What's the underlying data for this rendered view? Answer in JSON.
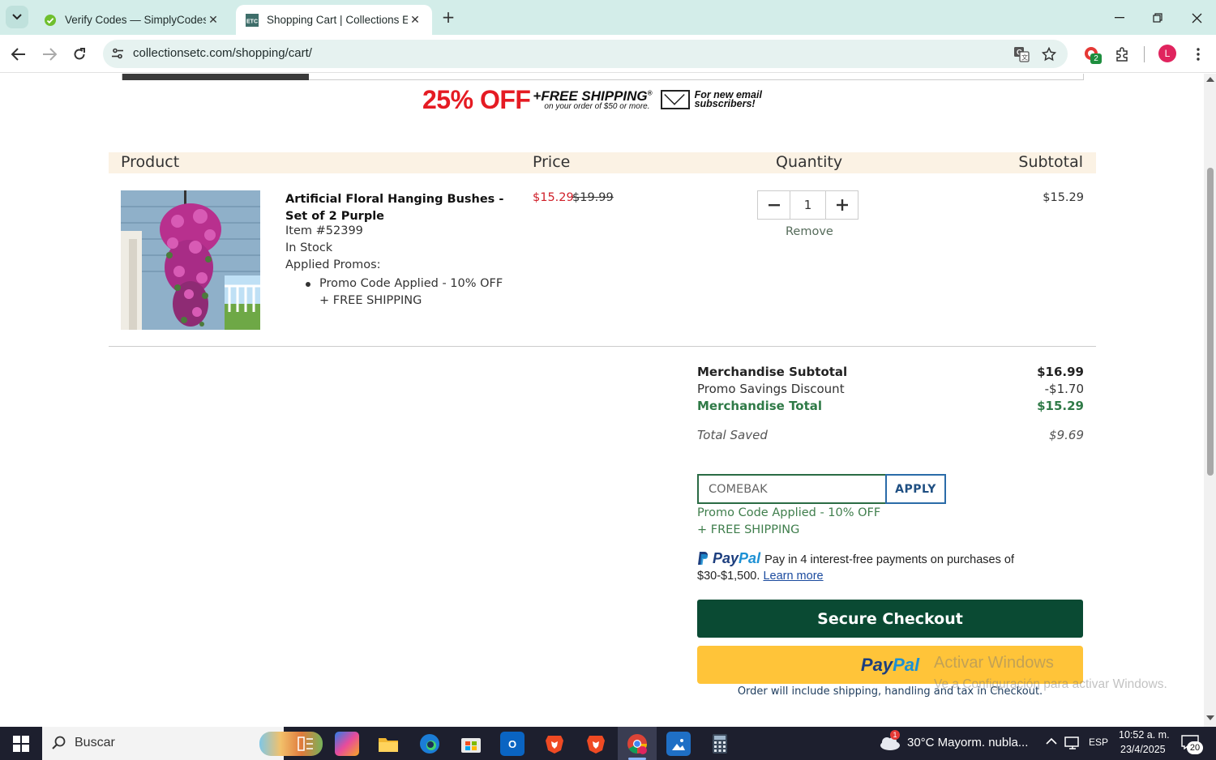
{
  "browser": {
    "tabs": [
      {
        "title": "Verify Codes — SimplyCodes",
        "active": false
      },
      {
        "title": "Shopping Cart | Collections Etc.",
        "active": true
      }
    ],
    "active_favicon_text": "ETC",
    "url": "collectionsetc.com/shopping/cart/",
    "extension_badge": "2",
    "profile_initial": "L"
  },
  "banner": {
    "discount": "25% OFF",
    "shipping": "+FREE SHIPPING",
    "shipping_reg": "®",
    "condition": "on your order of $50 or more.",
    "audience_line1": "For new email",
    "audience_line2": "subscribers!"
  },
  "table": {
    "headers": {
      "product": "Product",
      "price": "Price",
      "quantity": "Quantity",
      "subtotal": "Subtotal"
    }
  },
  "item": {
    "name": "Artificial Floral Hanging Bushes - Set of 2 Purple",
    "item_number": "Item #52399",
    "stock": "In Stock",
    "applied_promos_label": "Applied Promos:",
    "promo": "Promo Code Applied - 10% OFF + FREE SHIPPING",
    "sale_price": "$15.29",
    "original_price": "$19.99",
    "quantity": "1",
    "remove_label": "Remove",
    "subtotal": "$15.29"
  },
  "summary": {
    "merch_subtotal_label": "Merchandise Subtotal",
    "merch_subtotal": "$16.99",
    "promo_discount_label": "Promo Savings Discount",
    "promo_discount": "-$1.70",
    "merch_total_label": "Merchandise Total",
    "merch_total": "$15.29",
    "total_saved_label": "Total Saved",
    "total_saved": "$9.69"
  },
  "promo_form": {
    "code_value": "COMEBAK",
    "apply_label": "APPLY",
    "message": "Promo Code Applied - 10% OFF + FREE SHIPPING"
  },
  "paypal": {
    "logo_part1": "Pay",
    "logo_part2": "Pal",
    "message": "Pay in 4 interest-free payments on purchases of $30-$1,500.",
    "learn_more": "Learn more"
  },
  "checkout": {
    "secure_label": "Secure Checkout",
    "paypal_part1": "Pay",
    "paypal_part2": "Pal",
    "note": "Order will include shipping, handling and tax in Checkout."
  },
  "watermark": {
    "line1": "Activar Windows",
    "line2": "Ve a Configuración para activar Windows."
  },
  "taskbar": {
    "search_label": "Buscar",
    "weather_alert": "1",
    "weather": "30°C  Mayorm. nubla...",
    "language": "ESP",
    "time": "10:52 a. m.",
    "date": "23/4/2025",
    "notifications": "20"
  }
}
